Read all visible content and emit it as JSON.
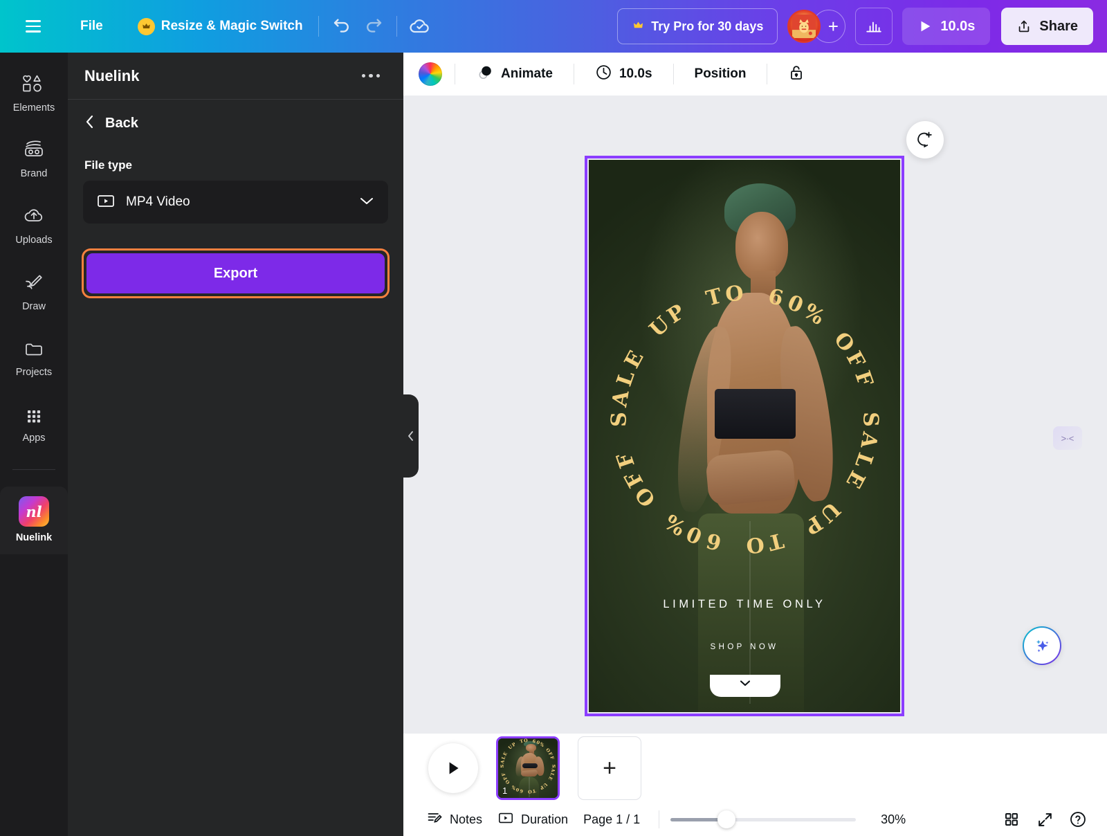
{
  "topbar": {
    "menu_icon": "hamburger-icon",
    "file_label": "File",
    "resize_label": "Resize & Magic Switch",
    "crown_icon": "crown-icon",
    "undo_icon": "undo-icon",
    "redo_icon": "redo-icon",
    "cloud_icon": "cloud-saved-icon",
    "try_pro_label": "Try Pro for 30 days",
    "avatar_icon": "avatar-cat",
    "add_collaborator_icon": "plus-icon",
    "analytics_icon": "bar-chart-icon",
    "play_icon": "play-icon",
    "duration_label": "10.0s",
    "share_icon": "share-upload-icon",
    "share_label": "Share"
  },
  "rail": {
    "items": [
      {
        "label": "Elements",
        "icon": "elements-icon"
      },
      {
        "label": "Brand",
        "icon": "brand-icon"
      },
      {
        "label": "Uploads",
        "icon": "uploads-cloud-icon"
      },
      {
        "label": "Draw",
        "icon": "draw-pen-icon"
      },
      {
        "label": "Projects",
        "icon": "projects-folder-icon"
      },
      {
        "label": "Apps",
        "icon": "apps-grid-icon"
      }
    ],
    "app": {
      "label": "Nuelink",
      "icon": "nuelink-logo",
      "mark": "nl"
    }
  },
  "panel": {
    "title": "Nuelink",
    "more_icon": "more-options-icon",
    "back_label": "Back",
    "back_icon": "chevron-left-icon",
    "file_type_label": "File type",
    "file_type_value": "MP4 Video",
    "file_type_icon": "video-file-icon",
    "chevron_icon": "chevron-down-icon",
    "export_label": "Export",
    "collapse_icon": "chevron-left-icon"
  },
  "subbar": {
    "color_icon": "color-wheel-icon",
    "animate_label": "Animate",
    "animate_icon": "animate-icon",
    "timing_label": "10.0s",
    "timing_icon": "clock-icon",
    "position_label": "Position",
    "lock_icon": "lock-open-icon"
  },
  "canvas": {
    "comment_icon": "add-comment-icon",
    "magic_icon": "magic-sparkle-icon",
    "edge_icon": "collapse-edge-icon",
    "bottom_handle_icon": "chevron-down-icon",
    "design": {
      "ring_text": "SALE UP TO 60% OFF SALE UP TO 60% OFF ",
      "headline": "LIMITED TIME ONLY",
      "cta": "SHOP NOW",
      "ring_color": "#f2cf7e",
      "background_color": "#25351c",
      "selection_color": "#8b3dff"
    }
  },
  "pages": {
    "play_icon": "play-icon",
    "thumbnails": [
      {
        "number": "1"
      }
    ],
    "add_page_icon": "plus-icon"
  },
  "bottombar": {
    "notes_label": "Notes",
    "notes_icon": "notes-icon",
    "duration_label": "Duration",
    "duration_icon": "duration-icon",
    "page_label": "Page 1 / 1",
    "zoom_value": "30%",
    "grid_icon": "grid-view-icon",
    "fullscreen_icon": "fullscreen-icon",
    "help_icon": "help-icon"
  },
  "colors": {
    "accent_purple": "#7d2ae8",
    "highlight_orange": "#f8803f",
    "selection_purple": "#8b3dff",
    "panel_bg": "#252627",
    "rail_bg": "#1c1c1e"
  }
}
